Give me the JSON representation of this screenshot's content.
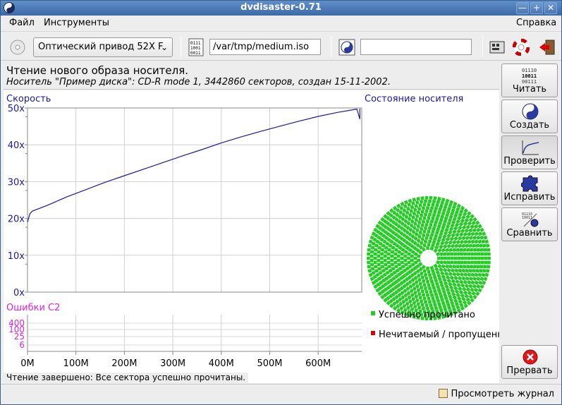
{
  "window": {
    "title": "dvdisaster-0.71"
  },
  "menu": {
    "file": "Файл",
    "tools": "Инструменты",
    "help": "Справка"
  },
  "toolbar": {
    "drive_label": "Оптический привод 52X F",
    "image_path": "/var/tmp/medium.iso",
    "ecc_path": ""
  },
  "header": {
    "line1": "Чтение нового образа носителя.",
    "line2": "Носитель \"Пример диска\": CD-R mode 1, 3442860 секторов, создан 15-11-2002."
  },
  "speed_panel": {
    "title": "Скорость",
    "y_ticks": [
      "50x",
      "40x",
      "30x",
      "20x",
      "10x",
      "0x"
    ]
  },
  "errors_panel": {
    "title": "Ошибки C2",
    "y_ticks": [
      "400",
      "100",
      "25",
      "6"
    ]
  },
  "x_ticks": [
    "0M",
    "100M",
    "200M",
    "300M",
    "400M",
    "500M",
    "600M"
  ],
  "media_panel": {
    "title": "Состояние носителя",
    "legend_ok": "Успешно прочитано",
    "legend_bad": "Нечитаемый / пропущенн"
  },
  "actions": {
    "read": "Читать",
    "create": "Создать",
    "verify": "Проверить",
    "fix": "Исправить",
    "compare": "Сравнить",
    "abort": "Прервать",
    "binary_icon_text": [
      "01110",
      "10011",
      "00111"
    ]
  },
  "status": {
    "message": "Чтение завершено: Все сектора успешно прочитаны."
  },
  "statusbar": {
    "log_button": "Просмотреть журнал"
  },
  "colors": {
    "speed_line": "#1a1aa0",
    "ok": "#22cc22",
    "bad": "#dd0000",
    "speed_title": "#1a1aa0",
    "errors_title": "#dd22dd"
  },
  "chart_data": {
    "type": "line",
    "title": "Скорость",
    "xlabel": "",
    "ylabel": "",
    "x_unit": "MB",
    "xlim": [
      0,
      690
    ],
    "ylim": [
      0,
      50
    ],
    "series": [
      {
        "x": [
          0,
          5,
          10,
          40,
          80,
          120,
          160,
          200,
          240,
          280,
          320,
          360,
          400,
          440,
          480,
          520,
          560,
          600,
          640,
          680,
          686
        ],
        "values": [
          19,
          21.3,
          22,
          23.5,
          25.8,
          27.8,
          29.8,
          31.6,
          33.4,
          35.2,
          37,
          38.7,
          40.5,
          42.1,
          43.6,
          45,
          46.4,
          47.7,
          48.8,
          49.7,
          47
        ]
      }
    ]
  }
}
